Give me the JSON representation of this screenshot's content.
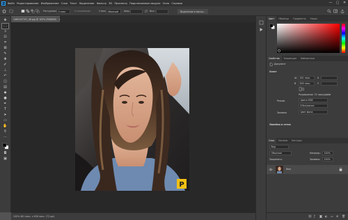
{
  "app": {
    "logo_text": "Ps"
  },
  "menubar": {
    "items": [
      "Файл",
      "Редактирование",
      "Изображение",
      "Слои",
      "Текст",
      "Выделение",
      "Фильтр",
      "3D",
      "Просмотр",
      "Подключаемые модули",
      "Окно",
      "Справка"
    ],
    "minimize": "—",
    "maximize": "▢",
    "close": "✕"
  },
  "options_bar": {
    "feather_label": "Растушевка:",
    "feather_value": "0 пикс",
    "antialias_label": "Сглаживание",
    "style_label": "Стиль:",
    "style_value": "Обычный",
    "width_label": "Шир.:",
    "height_label": "Выс.:",
    "select_mask_button": "Выделение и маска..."
  },
  "document": {
    "tab_title": "1465147747_46.jpg @ 100% (RGB/8#)",
    "tab_close": "×",
    "status_text": "100%     461 пикс. x 626 пикс. (72 ppi)",
    "watermark": "P"
  },
  "right_panel": {
    "color_tabs": [
      "Цвет",
      "Образцы",
      "Градиенты",
      "Узоры"
    ],
    "color_accent": "#e32f2f",
    "properties_tabs": [
      "Свойства",
      "Коррекция",
      "Библиотеки"
    ],
    "properties_type": "Документ",
    "canvas_header": "Холст",
    "width_label": "Ш",
    "width_value": "461 пикс.",
    "height_label": "В",
    "height_value": "626 пикс.",
    "x_label": "X",
    "y_label": "Y",
    "resolution_text": "Разрешение: 72 пикс/дюйм",
    "mode_label": "Режим",
    "mode_value": "Цвета RGB",
    "bit_value": "8 бит/канал",
    "fill_label": "Заливка",
    "fill_value": "Цвет фона",
    "rulers_header": "Линейки и сетки",
    "layers_tabs": [
      "Слои",
      "Каналы",
      "Контуры"
    ],
    "filter_label": "Вид",
    "blend_value": "Обычные",
    "opacity_label": "Непрозр.:",
    "opacity_value": "100%",
    "lock_label": "Закрепить:",
    "fill_pct_label": "Заливка:",
    "fill_pct_value": "100%",
    "layer_name": "Фон",
    "layer_lock_icon": "lock-icon"
  }
}
